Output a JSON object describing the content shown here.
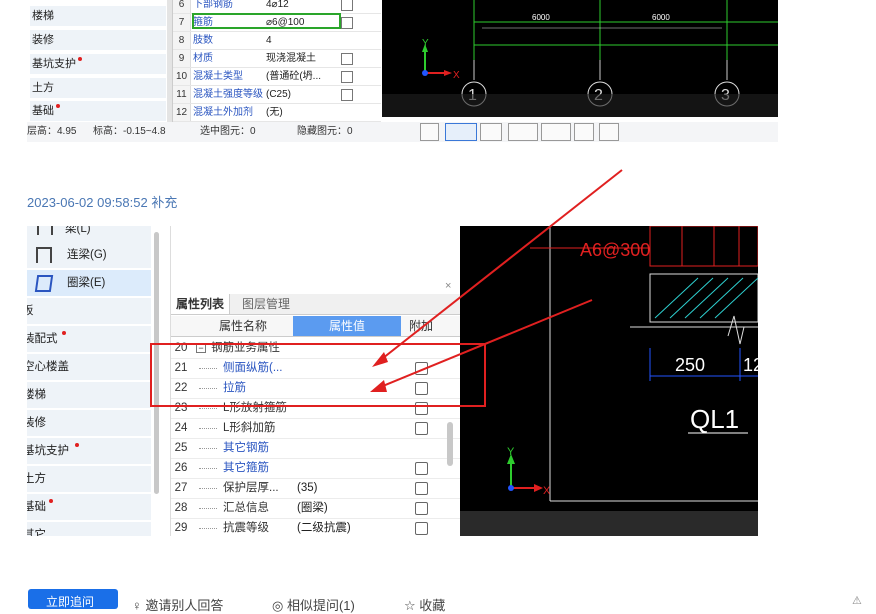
{
  "top_shot": {
    "sidebar": [
      {
        "label": "楼梯",
        "dot": false
      },
      {
        "label": "装修",
        "dot": false
      },
      {
        "label": "基坑支护",
        "dot": true
      },
      {
        "label": "土方",
        "dot": false
      },
      {
        "label": "基础",
        "dot": true
      }
    ],
    "table_rows": [
      {
        "no": "6",
        "name": "下部钢筋",
        "value": "4⌀12",
        "check": true
      },
      {
        "no": "7",
        "name": "箍筋",
        "value": "⌀6@100",
        "check": true
      },
      {
        "no": "8",
        "name": "肢数",
        "value": "4",
        "check": false
      },
      {
        "no": "9",
        "name": "材质",
        "value": "现浇混凝土",
        "check": true
      },
      {
        "no": "10",
        "name": "混凝土类型",
        "value": "(普通砼(坍...",
        "check": true
      },
      {
        "no": "11",
        "name": "混凝土强度等级",
        "value": "(C25)",
        "check": true
      },
      {
        "no": "12",
        "name": "混凝土外加剂",
        "value": "(无)",
        "check": false
      }
    ],
    "cad": {
      "dim_1": "6000",
      "dim_2": "6000",
      "axis_1": "1",
      "axis_2": "2",
      "axis_3": "3",
      "y_label": "Y",
      "x_label": "X"
    },
    "status": {
      "floor_height": "层高：4.95",
      "elevation": "标高：-0.15~4.8",
      "selected": "选中图元：0",
      "hidden": "隐藏图元：0"
    }
  },
  "timestamp": "2023-06-02 09:58:52 补充",
  "bottom_shot": {
    "sidebar": [
      {
        "label": "梁(L)",
        "dot": false,
        "icon": "beam-icon"
      },
      {
        "label": "连梁(G)",
        "dot": false,
        "icon": "coupling-beam-icon"
      },
      {
        "label": "圈梁(E)",
        "dot": false,
        "icon": "ring-beam-icon",
        "selected": true
      },
      {
        "label": "板",
        "dot": false
      },
      {
        "label": "装配式",
        "dot": true
      },
      {
        "label": "空心楼盖",
        "dot": false
      },
      {
        "label": "楼梯",
        "dot": false
      },
      {
        "label": "装修",
        "dot": false
      },
      {
        "label": "基坑支护",
        "dot": true
      },
      {
        "label": "土方",
        "dot": false
      },
      {
        "label": "基础",
        "dot": true
      },
      {
        "label": "其它",
        "dot": false
      }
    ],
    "tabs": [
      "属性列表",
      "图层管理"
    ],
    "headers": {
      "name": "属性名称",
      "value": "属性值",
      "extra": "附加"
    },
    "rows": [
      {
        "no": "20",
        "name": "钢筋业务属性",
        "value": "",
        "blue": false,
        "check": false,
        "group": true
      },
      {
        "no": "21",
        "name": "侧面纵筋(...",
        "value": "",
        "blue": true,
        "check": true
      },
      {
        "no": "22",
        "name": "拉筋",
        "value": "",
        "blue": true,
        "check": true
      },
      {
        "no": "23",
        "name": "L形放射箍筋",
        "value": "",
        "blue": false,
        "check": true
      },
      {
        "no": "24",
        "name": "L形斜加筋",
        "value": "",
        "blue": false,
        "check": true
      },
      {
        "no": "25",
        "name": "其它钢筋",
        "value": "",
        "blue": true,
        "check": false
      },
      {
        "no": "26",
        "name": "其它箍筋",
        "value": "",
        "blue": true,
        "check": true
      },
      {
        "no": "27",
        "name": "保护层厚...",
        "value": "(35)",
        "blue": false,
        "check": true
      },
      {
        "no": "28",
        "name": "汇总信息",
        "value": "(圈梁)",
        "blue": false,
        "check": true
      },
      {
        "no": "29",
        "name": "抗震等级",
        "value": "(二级抗震)",
        "blue": false,
        "check": true
      }
    ],
    "cad": {
      "rebar_label": "A6@300",
      "dim": "250",
      "dim2": "12",
      "beam_label": "QL1",
      "y_label": "Y",
      "x_label": "X"
    }
  },
  "bottom_bar": {
    "button": "立即追问",
    "link_1": "邀请别人回答",
    "link_2": "相似提问(1)",
    "link_3": "收藏"
  }
}
